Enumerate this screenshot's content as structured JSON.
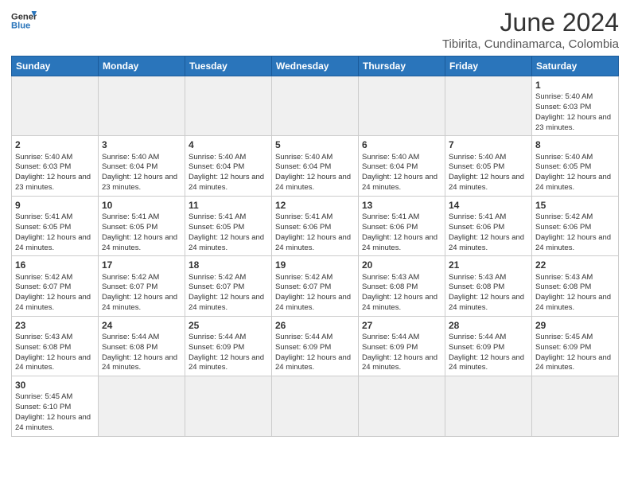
{
  "header": {
    "logo_general": "General",
    "logo_blue": "Blue",
    "title": "June 2024",
    "subtitle": "Tibirita, Cundinamarca, Colombia"
  },
  "days_of_week": [
    "Sunday",
    "Monday",
    "Tuesday",
    "Wednesday",
    "Thursday",
    "Friday",
    "Saturday"
  ],
  "weeks": [
    [
      {
        "day": "",
        "empty": true
      },
      {
        "day": "",
        "empty": true
      },
      {
        "day": "",
        "empty": true
      },
      {
        "day": "",
        "empty": true
      },
      {
        "day": "",
        "empty": true
      },
      {
        "day": "",
        "empty": true
      },
      {
        "day": "1",
        "sunrise": "5:40 AM",
        "sunset": "6:03 PM",
        "daylight": "12 hours and 23 minutes."
      }
    ],
    [
      {
        "day": "2",
        "sunrise": "5:40 AM",
        "sunset": "6:03 PM",
        "daylight": "12 hours and 23 minutes."
      },
      {
        "day": "3",
        "sunrise": "5:40 AM",
        "sunset": "6:04 PM",
        "daylight": "12 hours and 23 minutes."
      },
      {
        "day": "4",
        "sunrise": "5:40 AM",
        "sunset": "6:04 PM",
        "daylight": "12 hours and 24 minutes."
      },
      {
        "day": "5",
        "sunrise": "5:40 AM",
        "sunset": "6:04 PM",
        "daylight": "12 hours and 24 minutes."
      },
      {
        "day": "6",
        "sunrise": "5:40 AM",
        "sunset": "6:04 PM",
        "daylight": "12 hours and 24 minutes."
      },
      {
        "day": "7",
        "sunrise": "5:40 AM",
        "sunset": "6:05 PM",
        "daylight": "12 hours and 24 minutes."
      },
      {
        "day": "8",
        "sunrise": "5:40 AM",
        "sunset": "6:05 PM",
        "daylight": "12 hours and 24 minutes."
      }
    ],
    [
      {
        "day": "9",
        "sunrise": "5:41 AM",
        "sunset": "6:05 PM",
        "daylight": "12 hours and 24 minutes."
      },
      {
        "day": "10",
        "sunrise": "5:41 AM",
        "sunset": "6:05 PM",
        "daylight": "12 hours and 24 minutes."
      },
      {
        "day": "11",
        "sunrise": "5:41 AM",
        "sunset": "6:05 PM",
        "daylight": "12 hours and 24 minutes."
      },
      {
        "day": "12",
        "sunrise": "5:41 AM",
        "sunset": "6:06 PM",
        "daylight": "12 hours and 24 minutes."
      },
      {
        "day": "13",
        "sunrise": "5:41 AM",
        "sunset": "6:06 PM",
        "daylight": "12 hours and 24 minutes."
      },
      {
        "day": "14",
        "sunrise": "5:41 AM",
        "sunset": "6:06 PM",
        "daylight": "12 hours and 24 minutes."
      },
      {
        "day": "15",
        "sunrise": "5:42 AM",
        "sunset": "6:06 PM",
        "daylight": "12 hours and 24 minutes."
      }
    ],
    [
      {
        "day": "16",
        "sunrise": "5:42 AM",
        "sunset": "6:07 PM",
        "daylight": "12 hours and 24 minutes."
      },
      {
        "day": "17",
        "sunrise": "5:42 AM",
        "sunset": "6:07 PM",
        "daylight": "12 hours and 24 minutes."
      },
      {
        "day": "18",
        "sunrise": "5:42 AM",
        "sunset": "6:07 PM",
        "daylight": "12 hours and 24 minutes."
      },
      {
        "day": "19",
        "sunrise": "5:42 AM",
        "sunset": "6:07 PM",
        "daylight": "12 hours and 24 minutes."
      },
      {
        "day": "20",
        "sunrise": "5:43 AM",
        "sunset": "6:08 PM",
        "daylight": "12 hours and 24 minutes."
      },
      {
        "day": "21",
        "sunrise": "5:43 AM",
        "sunset": "6:08 PM",
        "daylight": "12 hours and 24 minutes."
      },
      {
        "day": "22",
        "sunrise": "5:43 AM",
        "sunset": "6:08 PM",
        "daylight": "12 hours and 24 minutes."
      }
    ],
    [
      {
        "day": "23",
        "sunrise": "5:43 AM",
        "sunset": "6:08 PM",
        "daylight": "12 hours and 24 minutes."
      },
      {
        "day": "24",
        "sunrise": "5:44 AM",
        "sunset": "6:08 PM",
        "daylight": "12 hours and 24 minutes."
      },
      {
        "day": "25",
        "sunrise": "5:44 AM",
        "sunset": "6:09 PM",
        "daylight": "12 hours and 24 minutes."
      },
      {
        "day": "26",
        "sunrise": "5:44 AM",
        "sunset": "6:09 PM",
        "daylight": "12 hours and 24 minutes."
      },
      {
        "day": "27",
        "sunrise": "5:44 AM",
        "sunset": "6:09 PM",
        "daylight": "12 hours and 24 minutes."
      },
      {
        "day": "28",
        "sunrise": "5:44 AM",
        "sunset": "6:09 PM",
        "daylight": "12 hours and 24 minutes."
      },
      {
        "day": "29",
        "sunrise": "5:45 AM",
        "sunset": "6:09 PM",
        "daylight": "12 hours and 24 minutes."
      }
    ],
    [
      {
        "day": "30",
        "sunrise": "5:45 AM",
        "sunset": "6:10 PM",
        "daylight": "12 hours and 24 minutes."
      },
      {
        "day": "",
        "empty": true
      },
      {
        "day": "",
        "empty": true
      },
      {
        "day": "",
        "empty": true
      },
      {
        "day": "",
        "empty": true
      },
      {
        "day": "",
        "empty": true
      },
      {
        "day": "",
        "empty": true
      }
    ]
  ]
}
